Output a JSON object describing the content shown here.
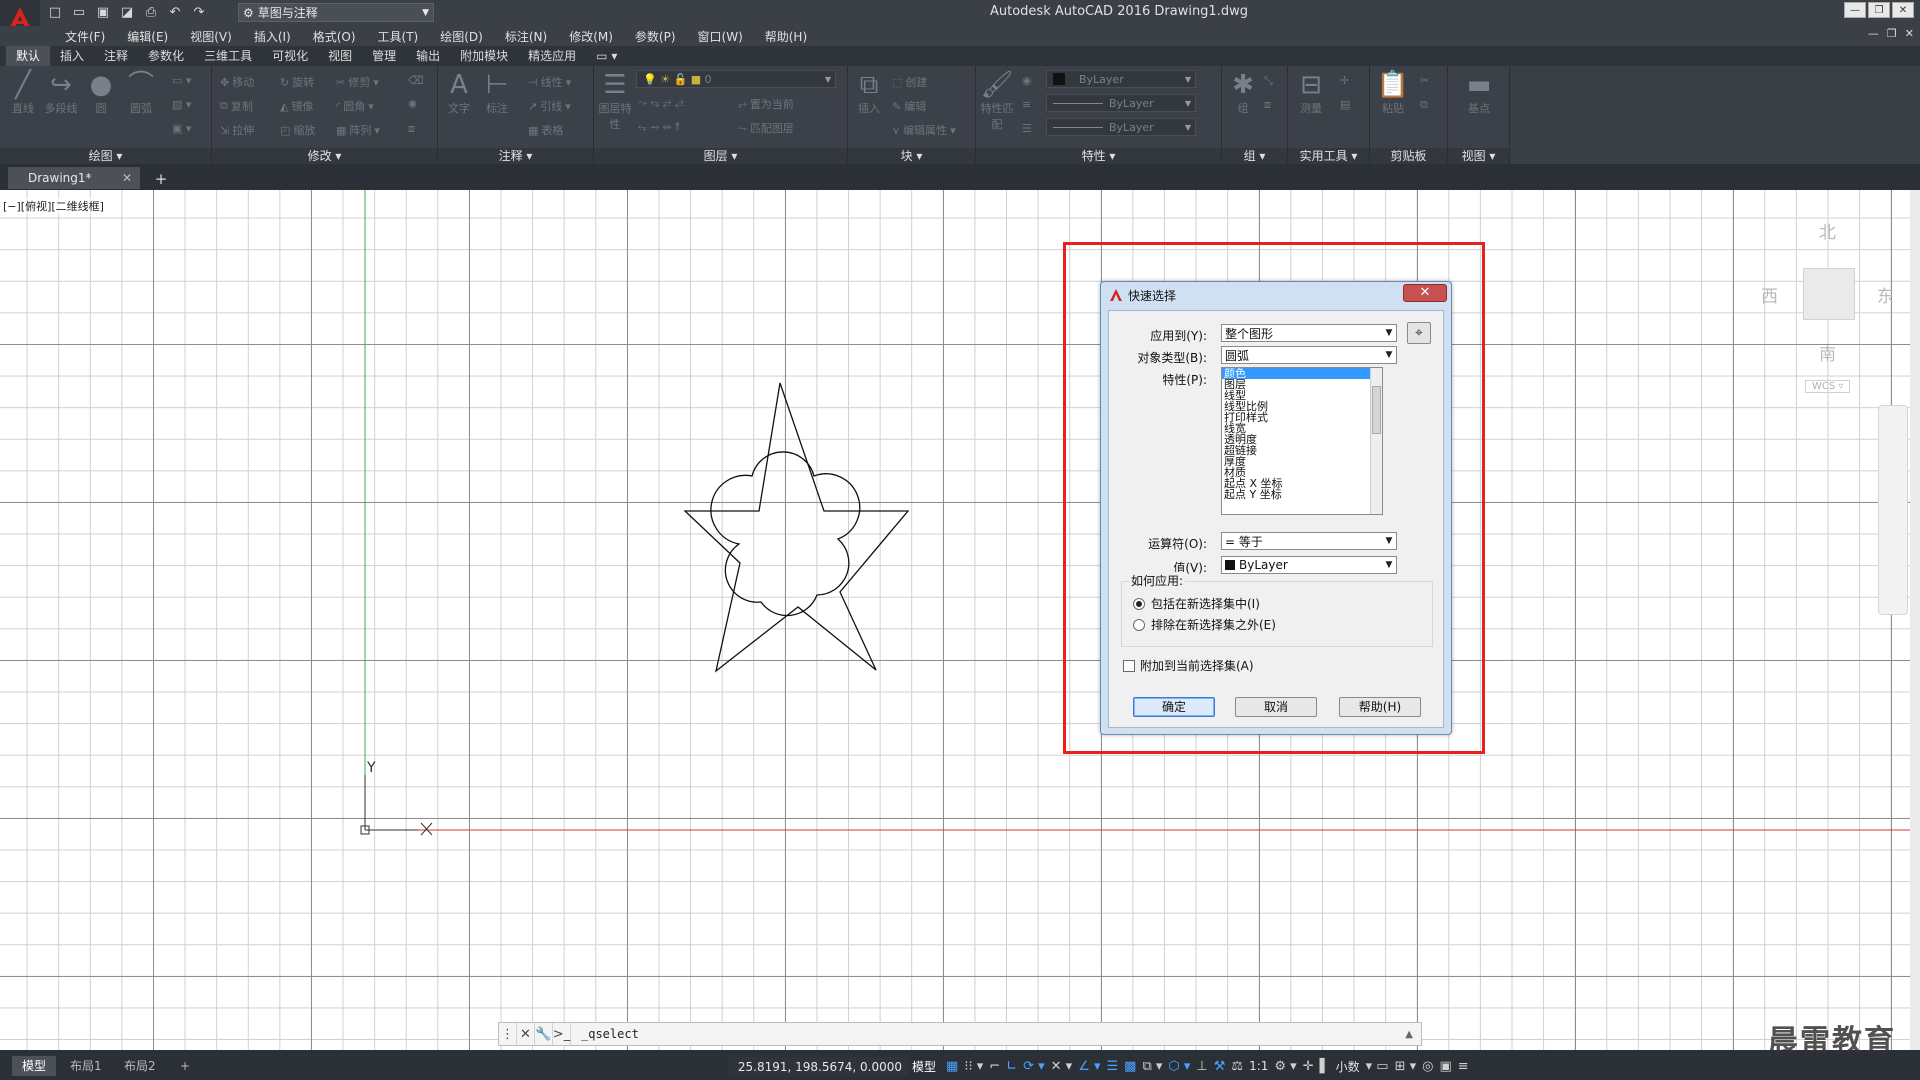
{
  "window": {
    "title": "Autodesk AutoCAD 2016    Drawing1.dwg",
    "workspace": "草图与注释"
  },
  "menu": [
    "文件(F)",
    "编辑(E)",
    "视图(V)",
    "插入(I)",
    "格式(O)",
    "工具(T)",
    "绘图(D)",
    "标注(N)",
    "修改(M)",
    "参数(P)",
    "窗口(W)",
    "帮助(H)"
  ],
  "ribbon_tabs": [
    "默认",
    "插入",
    "注释",
    "参数化",
    "三维工具",
    "可视化",
    "视图",
    "管理",
    "输出",
    "附加模块",
    "精选应用"
  ],
  "ribbon": {
    "draw": {
      "title": "绘图 ▾",
      "line": "直线",
      "polyline": "多段线",
      "circle": "圆",
      "arc": "圆弧"
    },
    "modify": {
      "title": "修改 ▾",
      "move": "移动",
      "rotate": "旋转",
      "trim": "修剪",
      "copy": "复制",
      "mirror": "镜像",
      "fillet": "圆角",
      "stretch": "拉伸",
      "scale": "缩放",
      "array": "阵列"
    },
    "annotation": {
      "title": "注释 ▾",
      "text": "文字",
      "dimension": "标注",
      "linear": "线性",
      "leader": "引线",
      "table": "表格"
    },
    "layers": {
      "title": "图层 ▾",
      "properties": "图层特性",
      "current": "0",
      "match": "置为当前",
      "matchlayer": "匹配图层"
    },
    "block": {
      "title": "块 ▾",
      "insert": "插入",
      "create": "创建",
      "edit": "编辑",
      "attr": "编辑属性"
    },
    "properties": {
      "title": "特性 ▾",
      "match": "特性匹配",
      "color": "ByLayer",
      "linetype": "ByLayer",
      "lineweight": "ByLayer"
    },
    "groups": {
      "title": "组 ▾",
      "group": "组"
    },
    "utilities": {
      "title": "实用工具 ▾",
      "measure": "测量"
    },
    "clipboard": {
      "title": "剪贴板",
      "paste": "粘贴"
    },
    "view": {
      "title": "视图 ▾",
      "base": "基点"
    }
  },
  "doc_tab": "Drawing1*",
  "viewport_label": "[−][俯视][二维线框]",
  "viewcube": {
    "north": "北",
    "south": "南",
    "east": "东",
    "west": "西",
    "wcs": "WCS ▿"
  },
  "ucs": {
    "x": "X",
    "y": "Y"
  },
  "dialog": {
    "title": "快速选择",
    "close": "✕",
    "apply_to_label": "应用到(Y):",
    "apply_to_value": "整个图形",
    "object_type_label": "对象类型(B):",
    "object_type_value": "圆弧",
    "properties_label": "特性(P):",
    "properties": [
      "颜色",
      "图层",
      "线型",
      "线型比例",
      "打印样式",
      "线宽",
      "透明度",
      "超链接",
      "厚度",
      "材质",
      "起点 X 坐标",
      "起点 Y 坐标"
    ],
    "selected_property": "颜色",
    "operator_label": "运算符(O):",
    "operator_value": "= 等于",
    "value_label": "值(V):",
    "value_value": "ByLayer",
    "how_to_apply": "如何应用:",
    "include_label": "包括在新选择集中(I)",
    "exclude_label": "排除在新选择集之外(E)",
    "append_label": "附加到当前选择集(A)",
    "ok": "确定",
    "cancel": "取消",
    "help": "帮助(H)"
  },
  "command_line": "_qselect",
  "status": {
    "layouts": [
      "模型",
      "布局1",
      "布局2"
    ],
    "coords": "25.8191, 198.5674, 0.0000",
    "model": "模型",
    "scale": "1:1",
    "units": "小数"
  },
  "watermark": "晨雷教育",
  "colors": {
    "accent": "#e8211f",
    "ribbon_bg": "#3c4048",
    "dialog_title_bg": "#cfe0f2",
    "selection": "#3399ff"
  }
}
